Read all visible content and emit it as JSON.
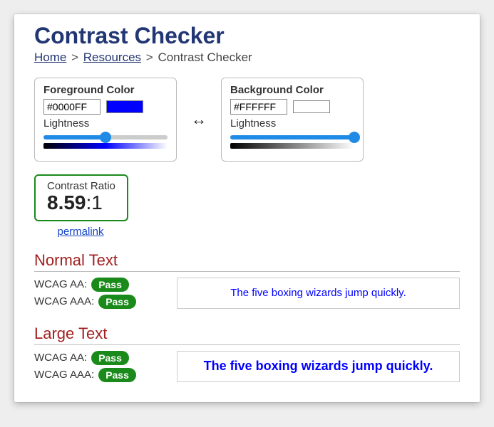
{
  "title": "Contrast Checker",
  "breadcrumb": {
    "home": "Home",
    "resources": "Resources",
    "current": "Contrast Checker"
  },
  "foreground": {
    "label": "Foreground Color",
    "hex": "#0000FF",
    "swatch": "#0000FF",
    "lightness_label": "Lightness",
    "slider_pct": 50
  },
  "background": {
    "label": "Background Color",
    "hex": "#FFFFFF",
    "swatch": "#FFFFFF",
    "lightness_label": "Lightness",
    "slider_pct": 100
  },
  "swap_icon": "↔",
  "ratio": {
    "title": "Contrast Ratio",
    "value": "8.59",
    "suffix": ":1",
    "permalink": "permalink"
  },
  "normal": {
    "heading": "Normal Text",
    "aa_label": "WCAG AA:",
    "aa_result": "Pass",
    "aaa_label": "WCAG AAA:",
    "aaa_result": "Pass",
    "sample": "The five boxing wizards jump quickly."
  },
  "large": {
    "heading": "Large Text",
    "aa_label": "WCAG AA:",
    "aa_result": "Pass",
    "aaa_label": "WCAG AAA:",
    "aaa_result": "Pass",
    "sample": "The five boxing wizards jump quickly."
  }
}
